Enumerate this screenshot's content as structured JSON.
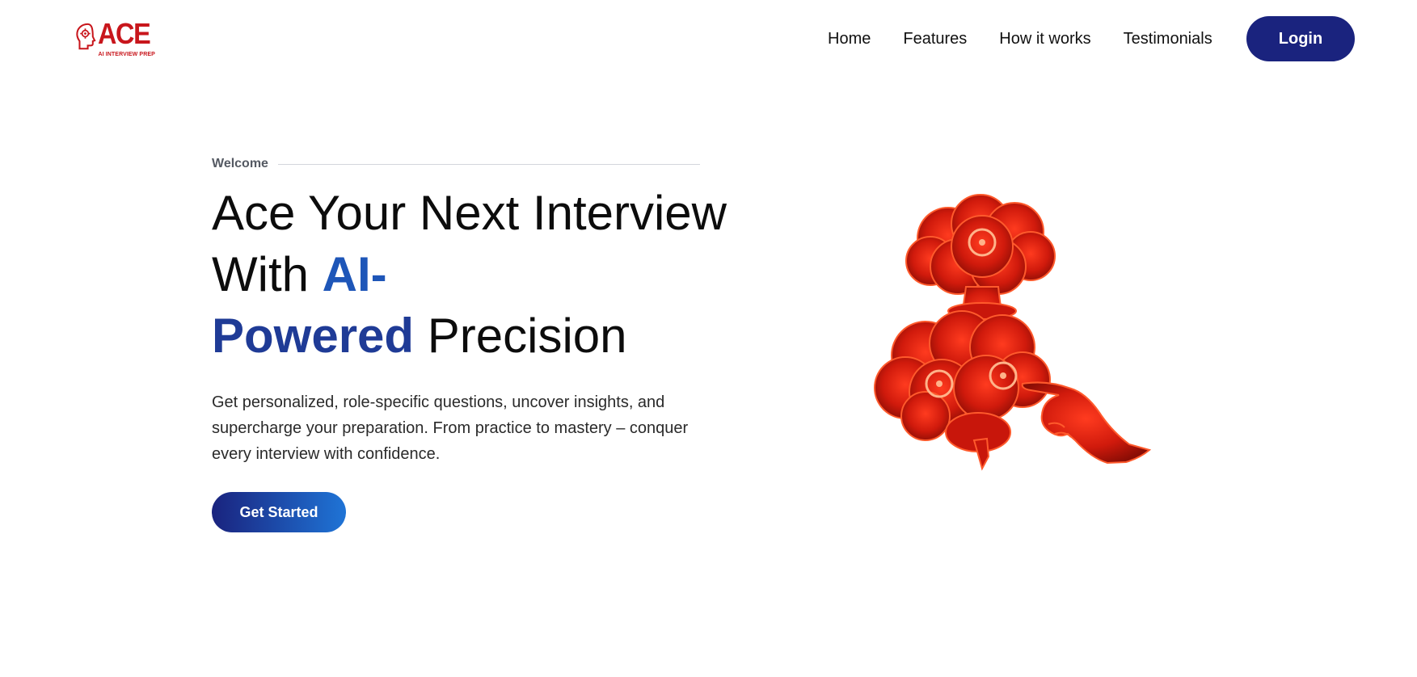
{
  "brand": {
    "name": "ACE",
    "tagline": "AI INTERVIEW PREP",
    "color": "#c8161c"
  },
  "nav": {
    "links": [
      "Home",
      "Features",
      "How it works",
      "Testimonials"
    ],
    "login_label": "Login"
  },
  "hero": {
    "eyebrow": "Welcome",
    "headline": {
      "part1": "Ace Your Next Interview With ",
      "highlight1": "AI-",
      "highlight2": "Powered",
      "part2": " Precision"
    },
    "description": "Get personalized, role-specific questions, uncover insights, and supercharge your preparation. From practice to mastery – conquer every interview with confidence.",
    "cta_label": "Get Started"
  },
  "illustration": {
    "icon": "exploding-brain-hand-icon"
  },
  "colors": {
    "navy": "#1a237e",
    "accent_blue": "#1e56b8",
    "accent_navy": "#1f3b96",
    "illustration_red": "#d81a0c"
  }
}
